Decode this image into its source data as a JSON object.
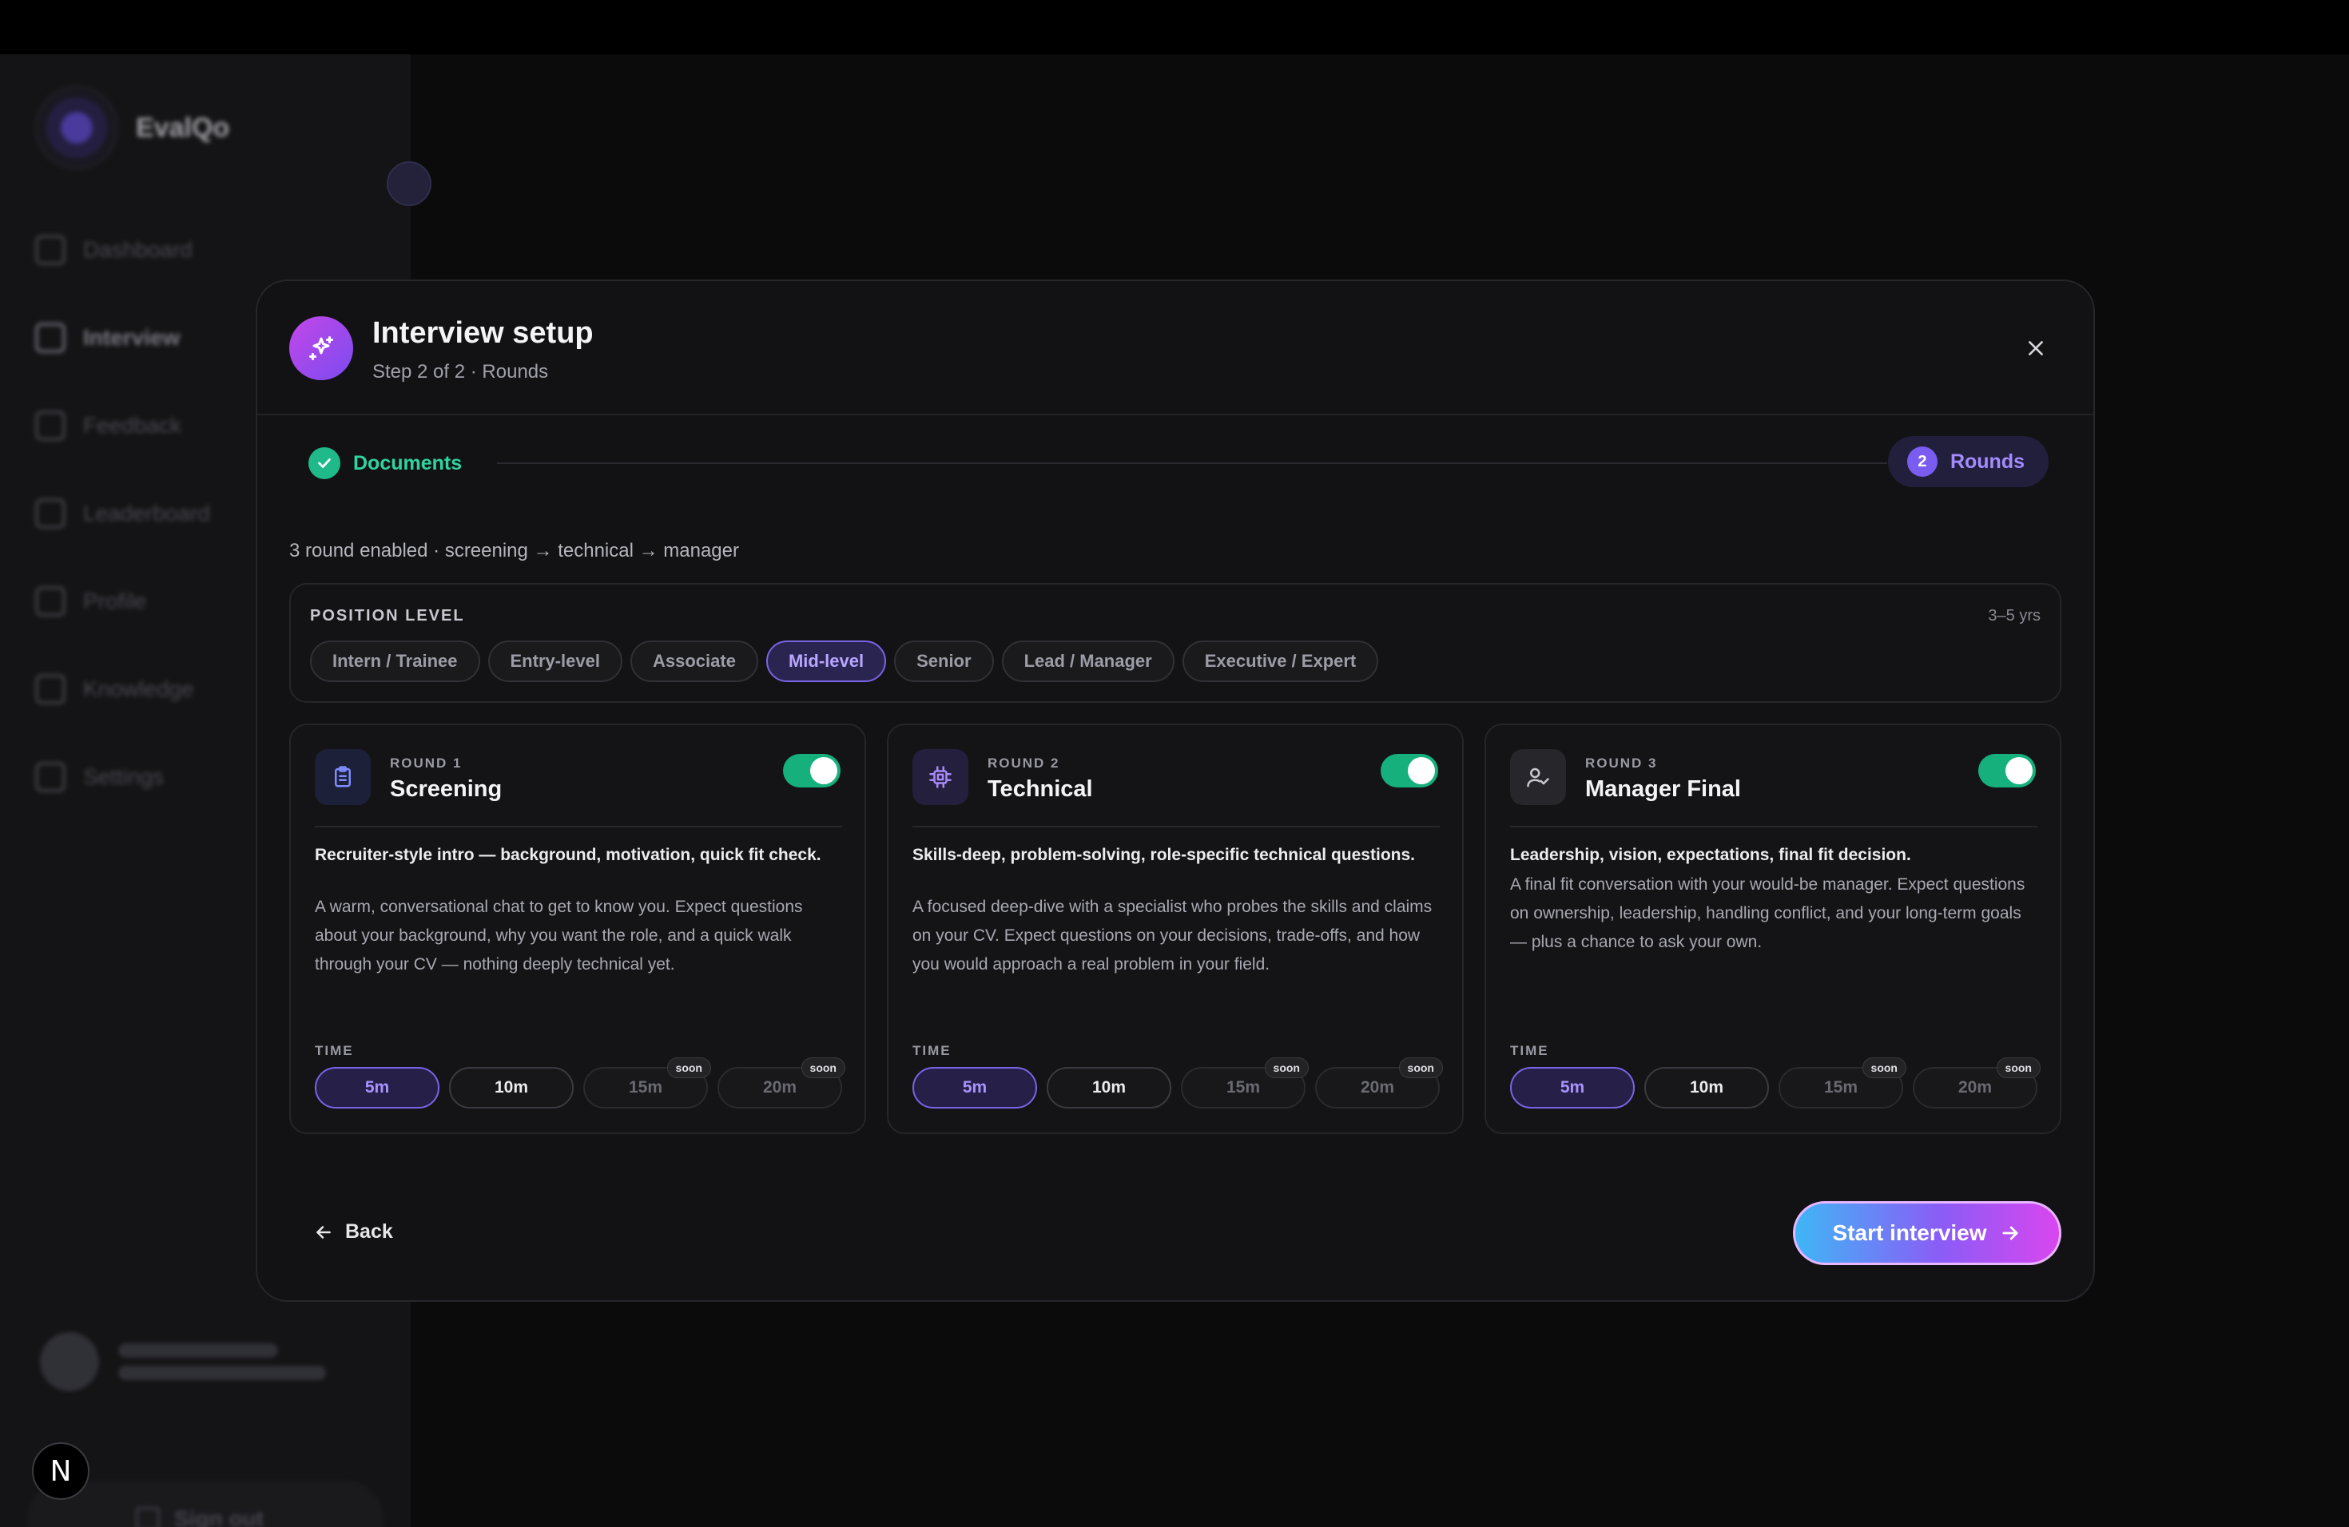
{
  "app": {
    "brand_name": "EvalQo"
  },
  "sidebar": {
    "items": [
      {
        "label": "Dashboard",
        "icon": "grid-icon"
      },
      {
        "label": "Interview",
        "icon": "mic-icon",
        "active": true
      },
      {
        "label": "Feedback",
        "icon": "message-icon"
      },
      {
        "label": "Leaderboard",
        "icon": "trophy-icon"
      },
      {
        "label": "Profile",
        "icon": "user-icon"
      },
      {
        "label": "Knowledge",
        "icon": "book-icon"
      },
      {
        "label": "Settings",
        "icon": "gear-icon"
      }
    ],
    "signout_label": "Sign out",
    "badge_letter": "N"
  },
  "modal": {
    "title": "Interview setup",
    "subtitle": "Step 2 of 2 · Rounds",
    "steps": {
      "done_label": "Documents",
      "current_number": "2",
      "current_label": "Rounds"
    },
    "summary": "3 round enabled · screening → technical → manager",
    "position_level": {
      "label": "POSITION LEVEL",
      "range": "3–5 yrs",
      "options": [
        "Intern / Trainee",
        "Entry-level",
        "Associate",
        "Mid-level",
        "Senior",
        "Lead / Manager",
        "Executive / Expert"
      ],
      "selected": "Mid-level"
    },
    "rounds": [
      {
        "eyebrow": "ROUND 1",
        "title": "Screening",
        "icon": "clipboard-icon",
        "enabled": true,
        "lead": "Recruiter-style intro — background, motivation, quick fit check.",
        "description": "A warm, conversational chat to get to know you. Expect questions about your background, why you want the role, and a quick walk through your CV — nothing deeply technical yet.",
        "time_label": "TIME",
        "times": [
          "5m",
          "10m",
          "15m",
          "20m"
        ],
        "selected_time": "5m"
      },
      {
        "eyebrow": "ROUND 2",
        "title": "Technical",
        "icon": "cpu-icon",
        "enabled": true,
        "lead": "Skills-deep, problem-solving, role-specific technical questions.",
        "description": "A focused deep-dive with a specialist who probes the skills and claims on your CV. Expect questions on your decisions, trade-offs, and how you would approach a real problem in your field.",
        "time_label": "TIME",
        "times": [
          "5m",
          "10m",
          "15m",
          "20m"
        ],
        "selected_time": "5m"
      },
      {
        "eyebrow": "ROUND 3",
        "title": "Manager Final",
        "icon": "user-check-icon",
        "enabled": true,
        "lead": "Leadership, vision, expectations, final fit decision.",
        "description": "A final fit conversation with your would-be manager. Expect questions on ownership, leadership, handling conflict, and your long-term goals — plus a chance to ask your own.",
        "time_label": "TIME",
        "times": [
          "5m",
          "10m",
          "15m",
          "20m"
        ],
        "selected_time": "5m"
      }
    ],
    "soon_label": "soon",
    "back_label": "Back",
    "start_label": "Start interview"
  },
  "colors": {
    "accent": "#7b63e6",
    "success": "#16b07c",
    "gradient_start": "#3fb6f6",
    "gradient_end": "#d946ef"
  }
}
